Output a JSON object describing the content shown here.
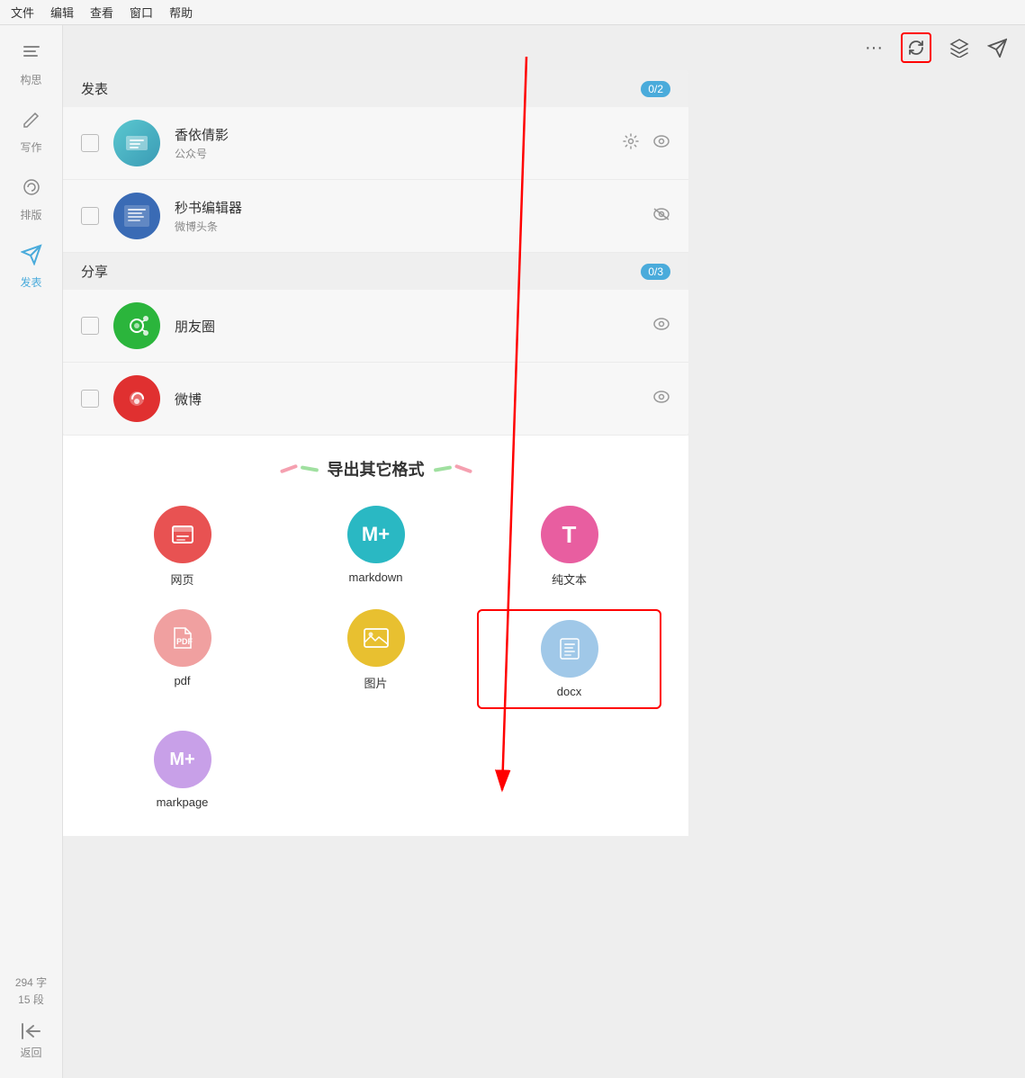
{
  "menu": {
    "items": [
      "文件",
      "编辑",
      "查看",
      "窗口",
      "帮助"
    ]
  },
  "sidebar": {
    "items": [
      {
        "id": "compose",
        "label": "构思",
        "icon": "≡"
      },
      {
        "id": "write",
        "label": "写作",
        "icon": "✏"
      },
      {
        "id": "layout",
        "label": "排版",
        "icon": "🎨"
      },
      {
        "id": "publish",
        "label": "发表",
        "icon": "✈",
        "active": true
      }
    ],
    "stats": {
      "chars": "294 字",
      "paragraphs": "15 段"
    },
    "return_label": "返回"
  },
  "toolbar": {
    "more_icon": "···",
    "refresh_icon": "⟳",
    "layers_icon": "⊛",
    "send_icon": "✈"
  },
  "publish_section": {
    "title": "发表",
    "badge": "0/2",
    "items": [
      {
        "name": "香依倩影",
        "type": "公众号",
        "avatar_type": "xiangyiping"
      },
      {
        "name": "秒书编辑器",
        "type": "微博头条",
        "avatar_type": "markdown"
      }
    ]
  },
  "share_section": {
    "title": "分享",
    "badge": "0/3",
    "items": [
      {
        "name": "朋友圈",
        "type": "",
        "avatar_type": "pengyouquan"
      },
      {
        "name": "微博",
        "type": "",
        "avatar_type": "weibo"
      }
    ]
  },
  "export_section": {
    "title": "导出其它格式",
    "items": [
      {
        "id": "webpage",
        "label": "网页",
        "color": "#e85252",
        "icon": "⊡"
      },
      {
        "id": "markdown",
        "label": "markdown",
        "color": "#2ab8c3",
        "icon": "M+"
      },
      {
        "id": "plaintext",
        "label": "纯文本",
        "color": "#e85ea0",
        "icon": "T"
      },
      {
        "id": "pdf",
        "label": "pdf",
        "color": "#f0a0a0",
        "icon": "Ⓐ"
      },
      {
        "id": "image",
        "label": "图片",
        "color": "#e8c030",
        "icon": "⊞"
      },
      {
        "id": "docx",
        "label": "docx",
        "color": "#a0c8e8",
        "icon": "≡"
      },
      {
        "id": "markpage",
        "label": "markpage",
        "color": "#c8a0e8",
        "icon": "M+"
      }
    ]
  },
  "deco": {
    "left_lines": [
      {
        "color": "#f5a0b0",
        "rotate": "-20deg"
      },
      {
        "color": "#a0e0a0",
        "rotate": "10deg"
      }
    ],
    "right_lines": [
      {
        "color": "#a0e0a0",
        "rotate": "-10deg"
      },
      {
        "color": "#f5a0b0",
        "rotate": "20deg"
      }
    ]
  }
}
